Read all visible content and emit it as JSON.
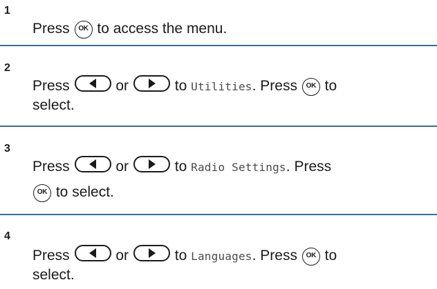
{
  "steps": [
    {
      "number": "1",
      "line1": {
        "pre": "Press",
        "post": "to access the menu."
      }
    },
    {
      "number": "2",
      "line1": {
        "pre": "Press",
        "or": "or",
        "to": "to",
        "target": "Utilities",
        "press": ". Press",
        "post": "to"
      },
      "line2": "select."
    },
    {
      "number": "3",
      "line1": {
        "pre": "Press",
        "or": "or",
        "to": "to",
        "target": "Radio Settings",
        "press": ". Press"
      },
      "line2": {
        "post": "to select."
      }
    },
    {
      "number": "4",
      "line1": {
        "pre": "Press",
        "or": "or",
        "to": "to",
        "target": "Languages",
        "press": ". Press",
        "post": "to"
      },
      "line2": "select."
    }
  ],
  "icons": {
    "ok_label": "OK",
    "left": "left-arrow-button-icon",
    "right": "right-arrow-button-icon",
    "ok": "ok-button-icon"
  },
  "colors": {
    "divider": "#2f6fa3",
    "text": "#1a1a1a",
    "menu_text": "#4a4a4a"
  }
}
